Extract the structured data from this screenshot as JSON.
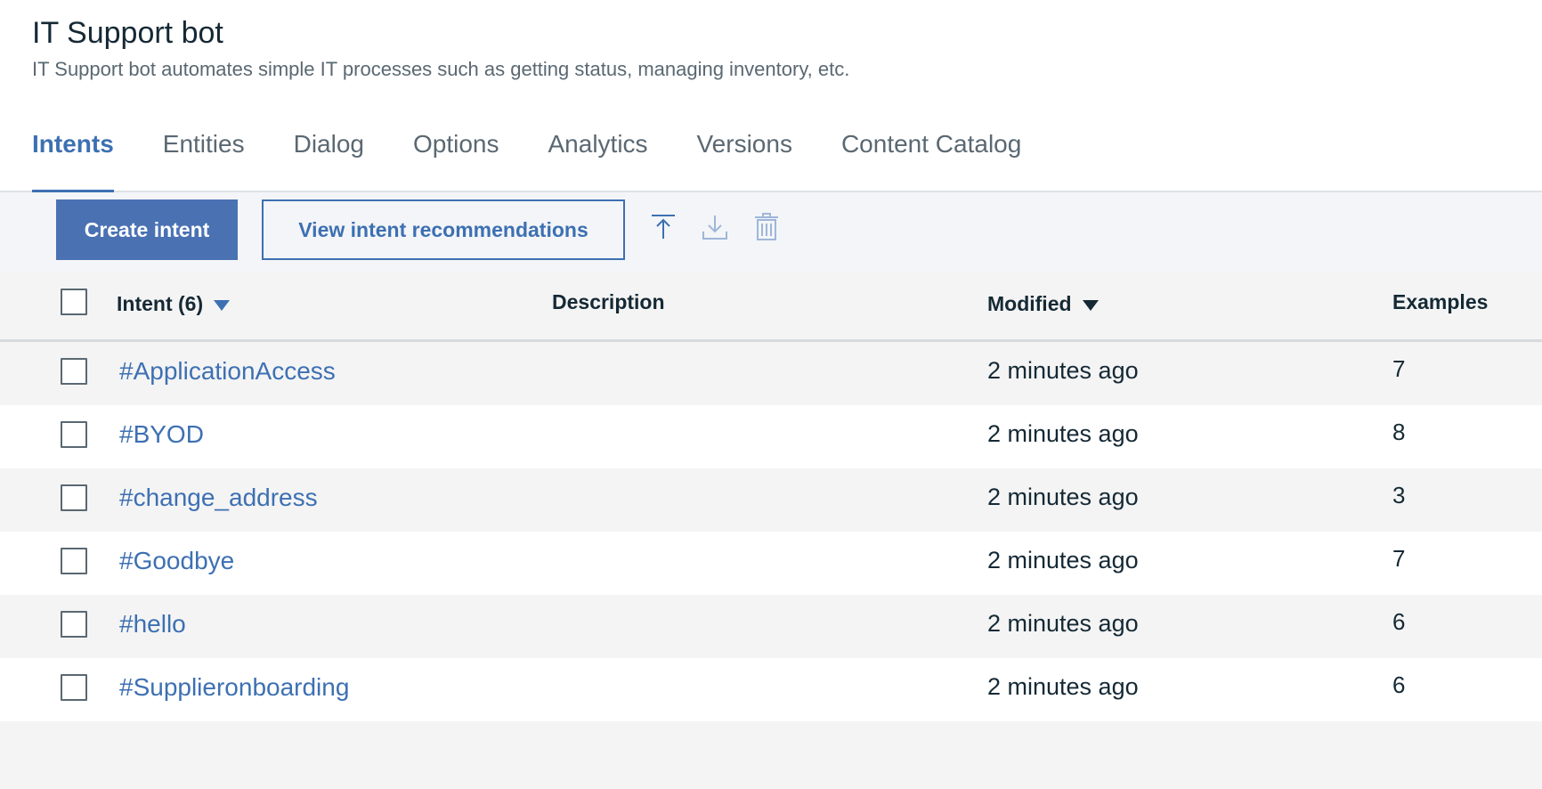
{
  "header": {
    "title": "IT Support bot",
    "subtitle": "IT Support bot automates simple IT processes such as getting status, managing inventory, etc."
  },
  "tabs": [
    {
      "label": "Intents",
      "active": true
    },
    {
      "label": "Entities",
      "active": false
    },
    {
      "label": "Dialog",
      "active": false
    },
    {
      "label": "Options",
      "active": false
    },
    {
      "label": "Analytics",
      "active": false
    },
    {
      "label": "Versions",
      "active": false
    },
    {
      "label": "Content Catalog",
      "active": false
    }
  ],
  "toolbar": {
    "create_label": "Create intent",
    "recommend_label": "View intent recommendations",
    "icons": [
      "upload-icon",
      "download-icon",
      "trash-icon"
    ]
  },
  "table": {
    "columns": {
      "intent": "Intent (6)",
      "description": "Description",
      "modified": "Modified",
      "examples": "Examples"
    },
    "rows": [
      {
        "intent": "#ApplicationAccess",
        "description": "",
        "modified": "2 minutes ago",
        "examples": "7"
      },
      {
        "intent": "#BYOD",
        "description": "",
        "modified": "2 minutes ago",
        "examples": "8"
      },
      {
        "intent": "#change_address",
        "description": "",
        "modified": "2 minutes ago",
        "examples": "3"
      },
      {
        "intent": "#Goodbye",
        "description": "",
        "modified": "2 minutes ago",
        "examples": "7"
      },
      {
        "intent": "#hello",
        "description": "",
        "modified": "2 minutes ago",
        "examples": "6"
      },
      {
        "intent": "#Supplieronboarding",
        "description": "",
        "modified": "2 minutes ago",
        "examples": "6"
      }
    ]
  },
  "colors": {
    "accent": "#3d70b2",
    "primary_button": "#4a72b3",
    "text": "#152935",
    "muted": "#5a6872"
  }
}
